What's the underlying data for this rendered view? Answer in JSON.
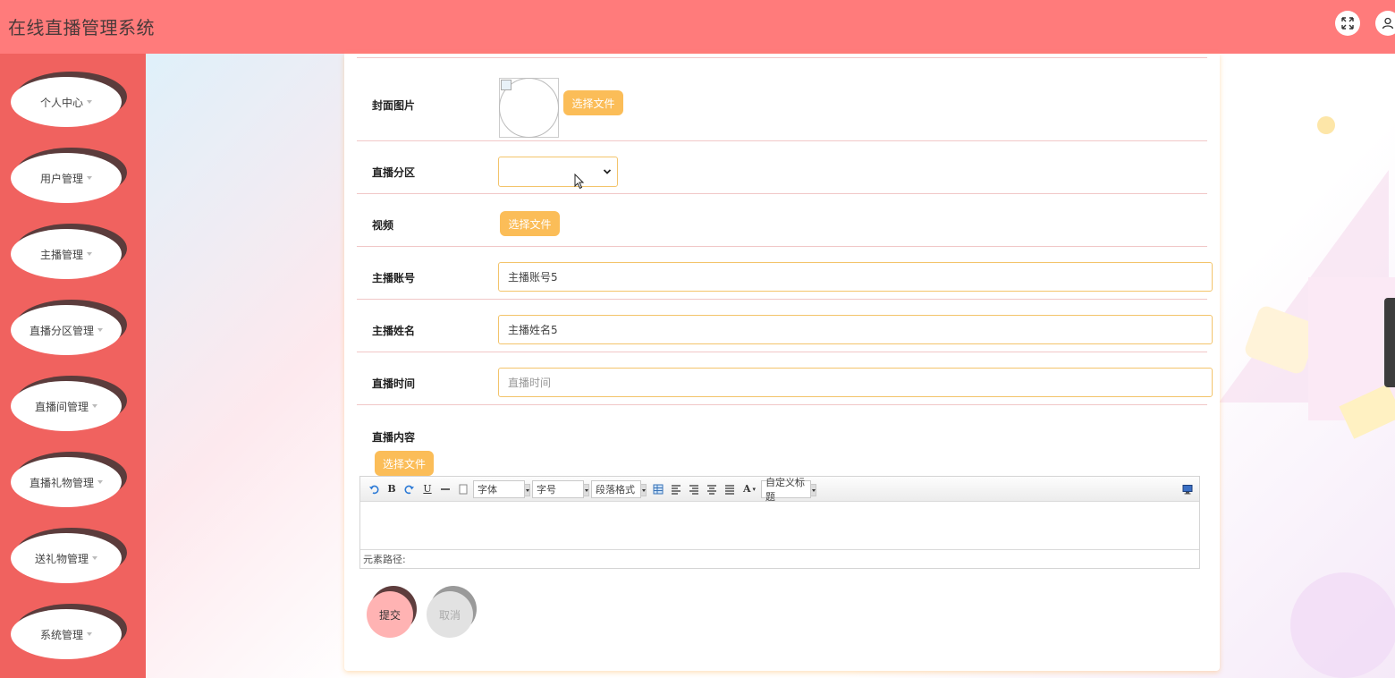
{
  "header": {
    "title": "在线直播管理系统",
    "icons": [
      "fullscreen-icon",
      "user-icon"
    ]
  },
  "sidebar": {
    "items": [
      {
        "label": "个人中心"
      },
      {
        "label": "用户管理"
      },
      {
        "label": "主播管理"
      },
      {
        "label": "直播分区管理"
      },
      {
        "label": "直播间管理"
      },
      {
        "label": "直播礼物管理"
      },
      {
        "label": "送礼物管理"
      },
      {
        "label": "系统管理"
      }
    ]
  },
  "form": {
    "cover": {
      "label": "封面图片",
      "button": "选择文件"
    },
    "category": {
      "label": "直播分区",
      "value": ""
    },
    "video": {
      "label": "视频",
      "button": "选择文件"
    },
    "anchor_account": {
      "label": "主播账号",
      "value": "主播账号5"
    },
    "anchor_name": {
      "label": "主播姓名",
      "value": "主播姓名5"
    },
    "live_time": {
      "label": "直播时间",
      "placeholder": "直播时间"
    },
    "content": {
      "label": "直播内容",
      "button": "选择文件",
      "toolbar": {
        "font": "字体",
        "size": "字号",
        "paragraph": "段落格式",
        "custom_title": "自定义标题"
      },
      "element_path": "元素路径:"
    }
  },
  "actions": {
    "submit": "提交",
    "cancel": "取消"
  },
  "colors": {
    "header": "#ff7b7b",
    "sidebar": "#f0625f",
    "accent": "#fbbd58",
    "submit": "#ffb3b3",
    "cancel": "#e2e2e2"
  }
}
